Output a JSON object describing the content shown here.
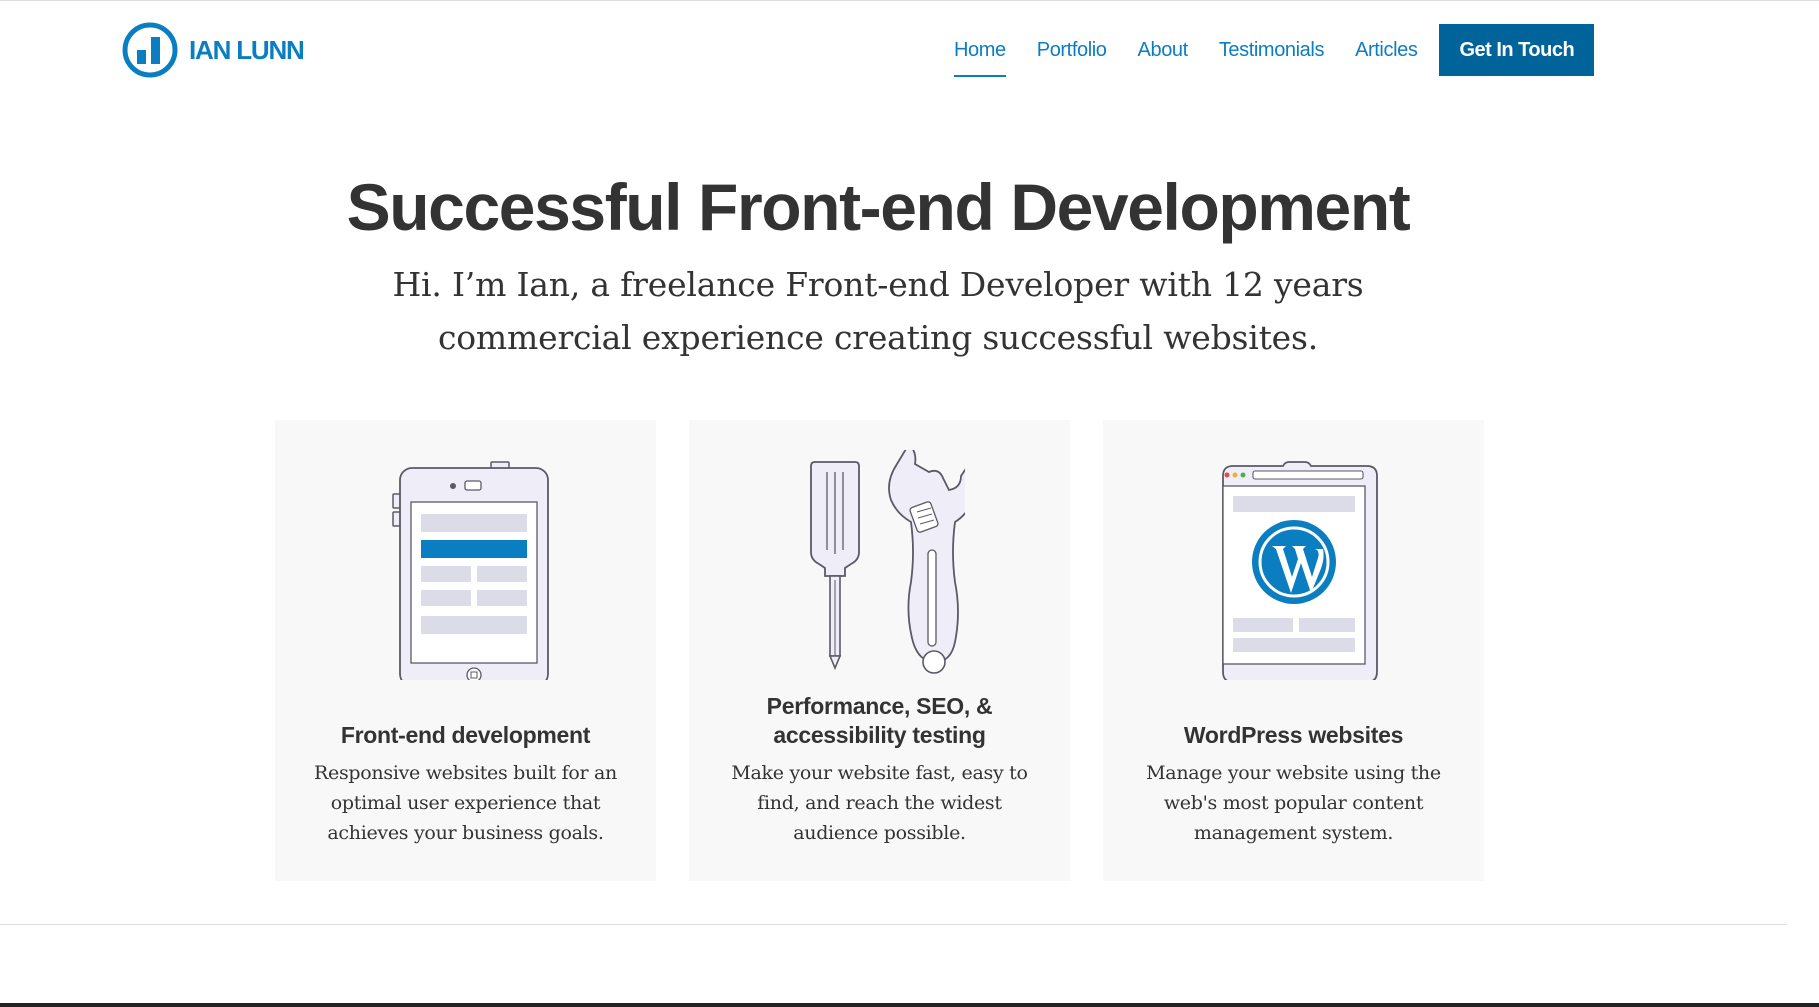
{
  "header": {
    "logo_text": "IAN LUNN",
    "nav": [
      {
        "label": "Home",
        "active": true
      },
      {
        "label": "Portfolio",
        "active": false
      },
      {
        "label": "About",
        "active": false
      },
      {
        "label": "Testimonials",
        "active": false
      },
      {
        "label": "Articles",
        "active": false
      }
    ],
    "cta_label": "Get In Touch"
  },
  "hero": {
    "title": "Successful Front-end Development",
    "subtitle_line1": "Hi. I’m Ian, a freelance Front-end Developer with 12 years",
    "subtitle_line2": "commercial experience creating successful websites."
  },
  "services": [
    {
      "icon": "tablet-icon",
      "title": "Front-end development",
      "description": "Responsive websites built for an optimal user experience that achieves your business goals."
    },
    {
      "icon": "tools-icon",
      "title_line1": "Performance, SEO, &",
      "title_line2": "accessibility testing",
      "description": "Make your website fast, easy to find, and reach the widest audience possible."
    },
    {
      "icon": "wordpress-icon",
      "title": "WordPress websites",
      "description": "Manage your website using the web's most popular content management system."
    }
  ],
  "colors": {
    "brand_blue": "#0b7ec2",
    "cta_blue": "#00649a",
    "text": "#333333",
    "card_bg": "#f8f8f8",
    "illustration_fill": "#eeedf8",
    "illustration_stroke": "#5a5a66"
  }
}
